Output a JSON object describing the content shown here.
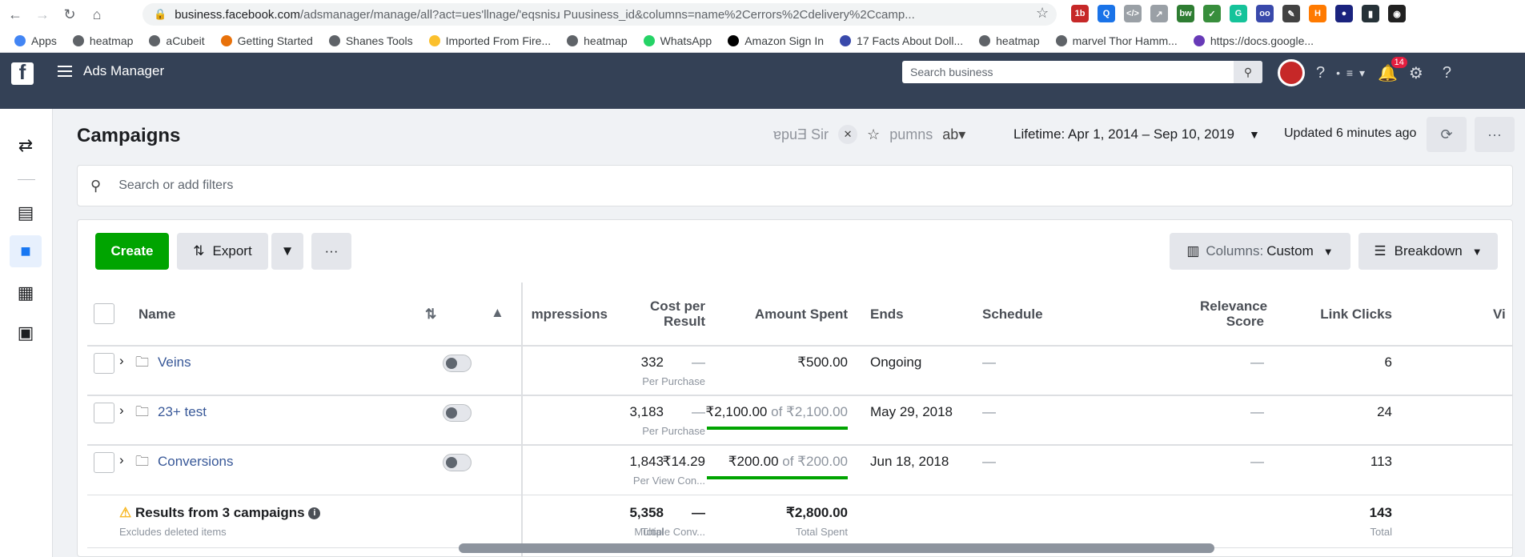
{
  "browser": {
    "url_host": "business.facebook.com",
    "url_rest": "/adsmanager/manage/all?act=ues'llnage/'eqsnisɹ Puusiness_id&columns=name%2Cerrors%2Cdelivery%2Ccamp...",
    "bookmarks": [
      "Apps",
      "heatmap",
      "aCubeit",
      "Getting Started",
      "Shanes Tools",
      "Imported From Fire...",
      "heatmap",
      "WhatsApp",
      "Amazon Sign In",
      "17 Facts About Doll...",
      "heatmap",
      "marvel Thor Hamm...",
      "https://docs.google..."
    ],
    "extensions": [
      {
        "label": "1b",
        "color": "#c62828"
      },
      {
        "label": "Q",
        "color": "#1a73e8"
      },
      {
        "label": "</>",
        "color": "#9aa0a6"
      },
      {
        "label": "↗",
        "color": "#9aa0a6"
      },
      {
        "label": "bw",
        "color": "#2e7d32"
      },
      {
        "label": "✓",
        "color": "#388e3c"
      },
      {
        "label": "G",
        "color": "#15c39a"
      },
      {
        "label": "oo",
        "color": "#3949ab"
      },
      {
        "label": "✎",
        "color": "#424242"
      },
      {
        "label": "H",
        "color": "#ff7a00"
      },
      {
        "label": "●",
        "color": "#1a237e"
      },
      {
        "label": "▮",
        "color": "#263238"
      },
      {
        "label": "◉",
        "color": "#212121"
      }
    ]
  },
  "topbar": {
    "app_name": "Ads Manager",
    "search_placeholder": "Search business",
    "notifications_count": "14"
  },
  "header": {
    "title": "Campaigns",
    "chips_text": "ɐpuƎ Sir",
    "columns_fragment": "pumns",
    "ends_fragment": "ab▾",
    "date_range": "Lifetime: Apr 1, 2014 – Sep 10, 2019",
    "updated": "Updated 6 minutes ago"
  },
  "filter": {
    "placeholder": "Search or add filters"
  },
  "toolbar": {
    "create_label": "Create",
    "export_label": "Export",
    "columns_prefix": "Columns:",
    "columns_value": "Custom",
    "breakdown_label": "Breakdown"
  },
  "table": {
    "headers": {
      "name": "Name",
      "impressions": "mpressions",
      "cost_per_result": "Cost per Result",
      "amount_spent": "Amount Spent",
      "ends": "Ends",
      "schedule": "Schedule",
      "relevance_score": "Relevance Score",
      "link_clicks": "Link Clicks",
      "next": "Vi"
    },
    "rows": [
      {
        "name": "Veins",
        "impressions": "332",
        "cost_per_result": "—",
        "cost_sub": "Per Purchase",
        "amount_spent": "₹500.00",
        "amount_of": "",
        "spent_fraction": 0,
        "ends": "Ongoing",
        "schedule": "—",
        "relevance": "—",
        "link_clicks": "6"
      },
      {
        "name": "23+ test",
        "impressions": "3,183",
        "cost_per_result": "—",
        "cost_sub": "Per Purchase",
        "amount_spent": "₹2,100.00",
        "amount_of": "of ₹2,100.00",
        "spent_fraction": 1,
        "ends": "May 29, 2018",
        "schedule": "—",
        "relevance": "—",
        "link_clicks": "24"
      },
      {
        "name": "Conversions",
        "impressions": "1,843",
        "cost_per_result": "₹14.29",
        "cost_sub": "Per View Con...",
        "amount_spent": "₹200.00",
        "amount_of": "of ₹200.00",
        "spent_fraction": 1,
        "ends": "Jun 18, 2018",
        "schedule": "—",
        "relevance": "—",
        "link_clicks": "113"
      }
    ],
    "totals": {
      "label": "Results from 3 campaigns",
      "sublabel": "Excludes deleted items",
      "impressions": "5,358",
      "impressions_sub": "Total",
      "cost_per_result": "—",
      "cost_sub": "Multiple Conv...",
      "amount_spent": "₹2,800.00",
      "amount_sub": "Total Spent",
      "link_clicks": "143",
      "link_clicks_sub": "Total"
    }
  }
}
